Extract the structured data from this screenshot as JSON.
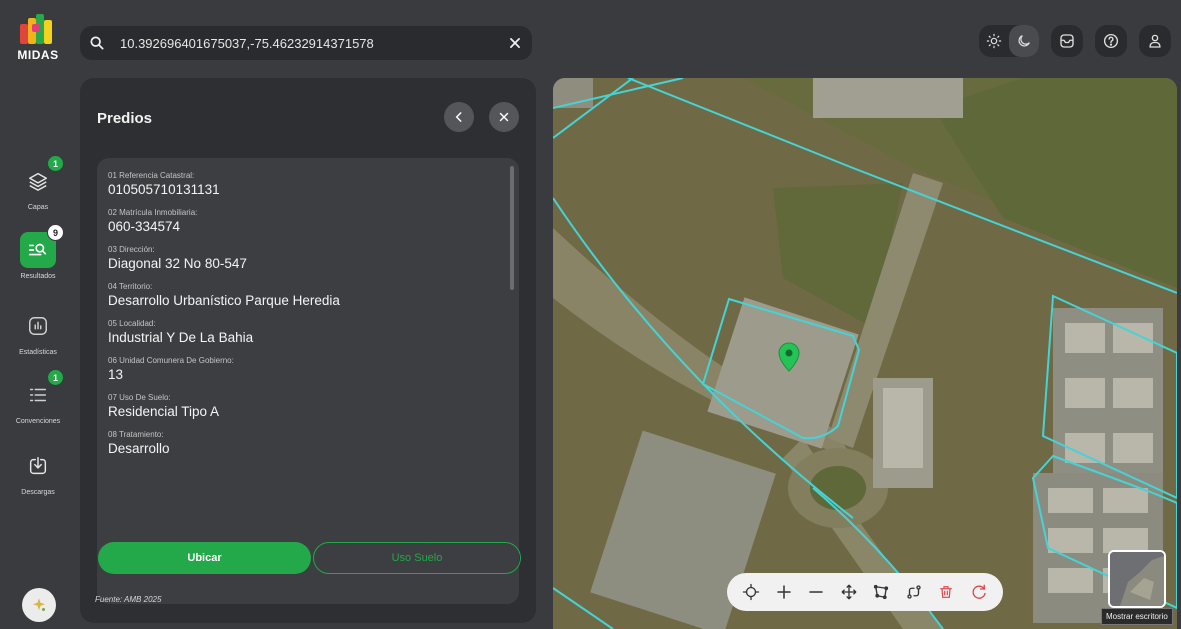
{
  "logo": {
    "text": "MIDAS"
  },
  "rail": {
    "items": [
      {
        "label": "Capas",
        "badge": "1",
        "icon": "layers-icon"
      },
      {
        "label": "Resultados",
        "badge": "9",
        "icon": "search-list-icon"
      },
      {
        "label": "Estadísticas",
        "badge": "",
        "icon": "bar-chart-icon"
      },
      {
        "label": "Convenciones",
        "badge": "1",
        "icon": "list-icon"
      },
      {
        "label": "Descargas",
        "badge": "",
        "icon": "download-icon"
      }
    ]
  },
  "search": {
    "value": "10.392696401675037,-75.46232914371578"
  },
  "panel": {
    "title": "Predios",
    "fields": [
      {
        "label": "01 Referencia Catastral:",
        "value": "010505710131131"
      },
      {
        "label": "02 Matrícula Inmobiliaria:",
        "value": "060-334574"
      },
      {
        "label": "03 Dirección:",
        "value": "Diagonal 32 No 80-547"
      },
      {
        "label": "04 Territorio:",
        "value": "Desarrollo Urbanístico Parque Heredia"
      },
      {
        "label": "05 Localidad:",
        "value": "Industrial Y De La Bahia"
      },
      {
        "label": "06 Unidad Comunera De Gobierno:",
        "value": "13"
      },
      {
        "label": "07 Uso De Suelo:",
        "value": "Residencial Tipo A"
      },
      {
        "label": "08 Tratamiento:",
        "value": "Desarrollo"
      }
    ],
    "btn_ubicar": "Ubicar",
    "btn_uso_suelo": "Uso Suelo",
    "source": "Fuente: AMB 2025"
  },
  "map": {
    "tooltip": "Mostrar escritorio",
    "toolbar": [
      "target-icon",
      "zoom-in-icon",
      "zoom-out-icon",
      "pan-icon",
      "polygon-icon",
      "route-icon",
      "trash-icon",
      "reset-icon"
    ]
  },
  "colors": {
    "accent": "#23a84a",
    "parcel_outline": "#45d3d6",
    "marker": "#23c455",
    "delete": "#e0454b"
  }
}
